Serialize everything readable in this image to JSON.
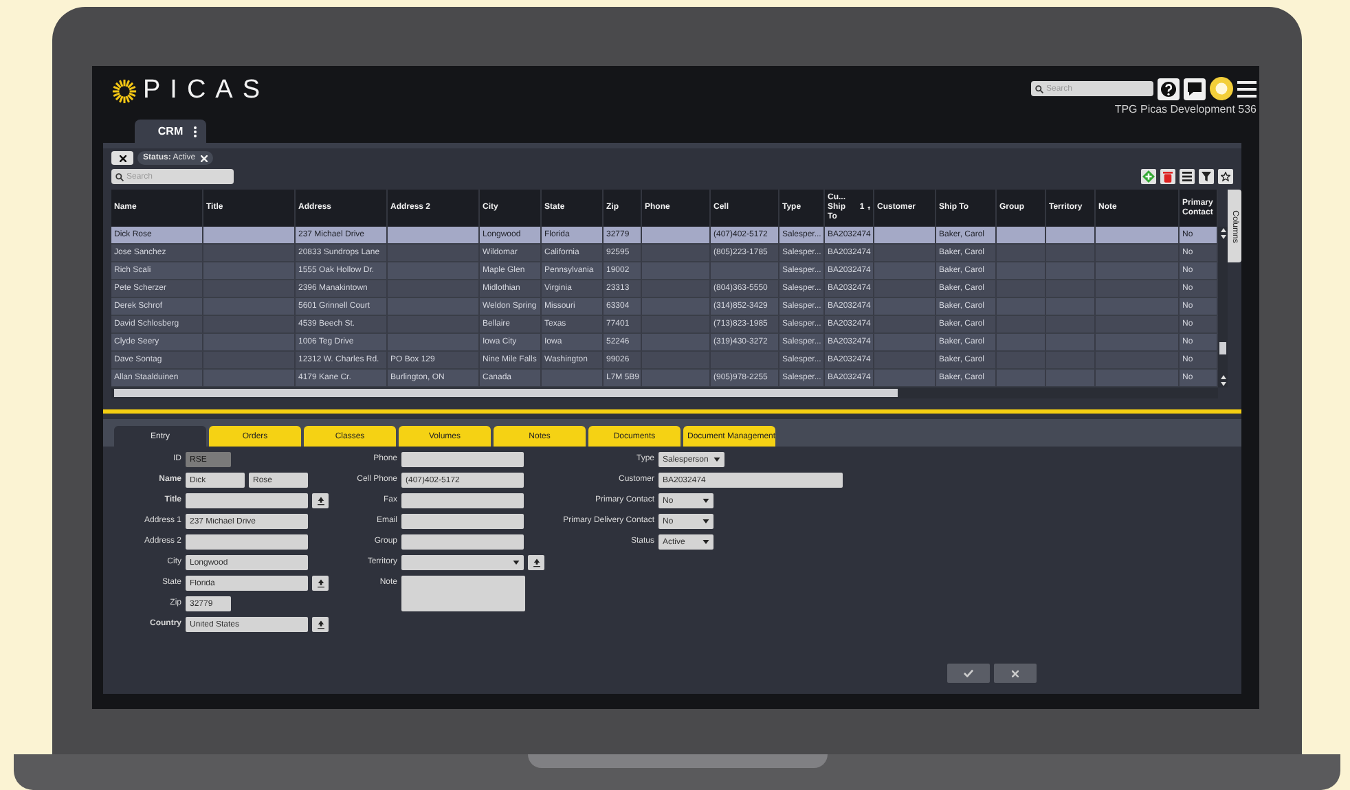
{
  "app": {
    "logo": "PICAS",
    "search": {
      "placeholder": "Search"
    },
    "instance": "TPG Picas Development 536"
  },
  "module_tab": {
    "label": "CRM"
  },
  "filters": [
    {
      "label": "Status:",
      "value": "Active"
    }
  ],
  "list_search": {
    "placeholder": "Search"
  },
  "table": {
    "columns": [
      {
        "label": "Name"
      },
      {
        "label": "Title"
      },
      {
        "label": "Address"
      },
      {
        "label": "Address 2"
      },
      {
        "label": "City"
      },
      {
        "label": "State"
      },
      {
        "label": "Zip"
      },
      {
        "label": "Phone"
      },
      {
        "label": "Cell"
      },
      {
        "label": "Type"
      },
      {
        "label": "Cu... Ship To",
        "sort_rank": "1"
      },
      {
        "label": "Customer"
      },
      {
        "label": "Ship To"
      },
      {
        "label": "Group"
      },
      {
        "label": "Territory"
      },
      {
        "label": "Note"
      },
      {
        "label": "Primary Contact"
      }
    ],
    "rows": [
      {
        "selected": true,
        "cells": [
          "Dick Rose",
          "",
          "237 Michael Drive",
          "",
          "Longwood",
          "Florida",
          "32779",
          "",
          "(407)402-5172",
          "Salesper...",
          "BA2032474",
          "",
          "Baker, Carol",
          "",
          "",
          "",
          "No"
        ]
      },
      {
        "selected": false,
        "cells": [
          "Jose Sanchez",
          "",
          "20833 Sundrops Lane",
          "",
          "Wildomar",
          "California",
          "92595",
          "",
          "(805)223-1785",
          "Salesper...",
          "BA2032474",
          "",
          "Baker, Carol",
          "",
          "",
          "",
          "No"
        ]
      },
      {
        "selected": false,
        "cells": [
          "Rich Scali",
          "",
          "1555 Oak Hollow Dr.",
          "",
          "Maple Glen",
          "Pennsylvania",
          "19002",
          "",
          "",
          "Salesper...",
          "BA2032474",
          "",
          "Baker, Carol",
          "",
          "",
          "",
          "No"
        ]
      },
      {
        "selected": false,
        "cells": [
          "Pete Scherzer",
          "",
          "2396 Manakintown",
          "",
          "Midlothian",
          "Virginia",
          "23313",
          "",
          "(804)363-5550",
          "Salesper...",
          "BA2032474",
          "",
          "Baker, Carol",
          "",
          "",
          "",
          "No"
        ]
      },
      {
        "selected": false,
        "cells": [
          "Derek Schrof",
          "",
          "5601 Grinnell Court",
          "",
          "Weldon Spring",
          "Missouri",
          "63304",
          "",
          "(314)852-3429",
          "Salesper...",
          "BA2032474",
          "",
          "Baker, Carol",
          "",
          "",
          "",
          "No"
        ]
      },
      {
        "selected": false,
        "cells": [
          "David Schlosberg",
          "",
          "4539 Beech St.",
          "",
          "Bellaire",
          "Texas",
          "77401",
          "",
          "(713)823-1985",
          "Salesper...",
          "BA2032474",
          "",
          "Baker, Carol",
          "",
          "",
          "",
          "No"
        ]
      },
      {
        "selected": false,
        "cells": [
          "Clyde Seery",
          "",
          "1006 Teg Drive",
          "",
          "Iowa City",
          "Iowa",
          "52246",
          "",
          "(319)430-3272",
          "Salesper...",
          "BA2032474",
          "",
          "Baker, Carol",
          "",
          "",
          "",
          "No"
        ]
      },
      {
        "selected": false,
        "cells": [
          "Dave Sontag",
          "",
          "12312 W. Charles Rd.",
          "PO Box 129",
          "Nine Mile Falls",
          "Washington",
          "99026",
          "",
          "",
          "Salesper...",
          "BA2032474",
          "",
          "Baker, Carol",
          "",
          "",
          "",
          "No"
        ]
      },
      {
        "selected": false,
        "cells": [
          "Allan Staalduinen",
          "",
          "4179 Kane Cr.",
          "Burlington, ON",
          "Canada",
          "",
          "L7M 5B9",
          "",
          "(905)978-2255",
          "Salesper...",
          "BA2032474",
          "",
          "Baker, Carol",
          "",
          "",
          "",
          "No"
        ]
      }
    ]
  },
  "columns_tab": "Columns",
  "detail_tabs": [
    {
      "label": "Entry",
      "selected": true
    },
    {
      "label": "Orders",
      "selected": false
    },
    {
      "label": "Classes",
      "selected": false
    },
    {
      "label": "Volumes",
      "selected": false
    },
    {
      "label": "Notes",
      "selected": false
    },
    {
      "label": "Documents",
      "selected": false
    },
    {
      "label": "Document Management",
      "selected": false
    }
  ],
  "form": {
    "columns": [
      [
        {
          "label": "ID",
          "kind": "text",
          "value": "RSE",
          "disabled": true
        },
        {
          "label": "Name",
          "kind": "pair",
          "values": [
            "Dick",
            "Rose"
          ],
          "required": true
        },
        {
          "label": "Title",
          "kind": "text",
          "lookup": true,
          "required": true
        },
        {
          "label": "Address 1",
          "kind": "text",
          "value": "237 Michael Drive"
        },
        {
          "label": "Address 2",
          "kind": "text"
        },
        {
          "label": "City",
          "kind": "text",
          "value": "Longwood"
        },
        {
          "label": "State",
          "kind": "text",
          "value": "Florida",
          "lookup": true
        },
        {
          "label": "Zip",
          "kind": "text",
          "value": "32779"
        },
        {
          "label": "Country",
          "kind": "text",
          "value": "United States",
          "lookup": true,
          "required": true
        }
      ],
      [
        {
          "label": "Phone",
          "kind": "text"
        },
        {
          "label": "Cell Phone",
          "kind": "text",
          "value": "(407)402-5172"
        },
        {
          "label": "Fax",
          "kind": "text"
        },
        {
          "label": "Email",
          "kind": "text"
        },
        {
          "label": "Group",
          "kind": "text"
        },
        {
          "label": "Territory",
          "kind": "select",
          "lookup": true
        },
        {
          "label": "Note",
          "kind": "textarea"
        }
      ],
      [
        {
          "label": "Type",
          "kind": "select",
          "value": "Salesperson"
        },
        {
          "label": "Customer",
          "kind": "text",
          "value": "BA2032474"
        },
        {
          "label": "Primary Contact",
          "kind": "select",
          "value": "No"
        },
        {
          "label": "Primary Delivery Contact",
          "kind": "select",
          "value": "No"
        },
        {
          "label": "Status",
          "kind": "select",
          "value": "Active"
        }
      ]
    ]
  }
}
